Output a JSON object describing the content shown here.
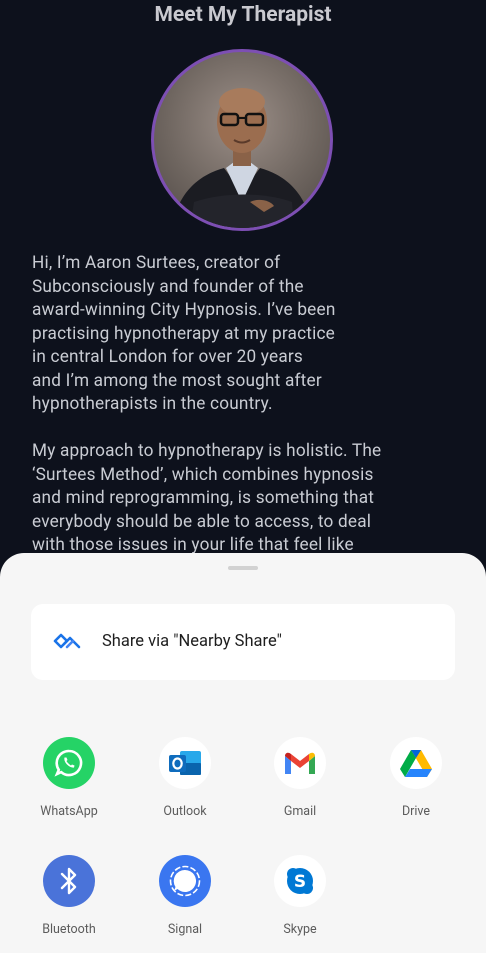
{
  "page": {
    "title": "Meet My Therapist",
    "bio_paragraphs": [
      "Hi, I’m Aaron Surtees, creator of\nSubconsciously and founder of the\naward-winning City Hypnosis. I’ve been\npractising hypnotherapy at my practice\nin central London for over 20 years\nand I’m among the most sought after\nhypnotherapists in the country.",
      "My approach to hypnotherapy is holistic. The\n‘Surtees Method’, which combines hypnosis\nand mind reprogramming, is something that\neverybody should be able to access, to deal\nwith those issues in your life that feel like"
    ],
    "avatar_ring_color": "#7d4fb3"
  },
  "share_sheet": {
    "nearby_label": "Share via \"Nearby Share\"",
    "apps": [
      {
        "label": "WhatsApp",
        "icon": "whatsapp-icon"
      },
      {
        "label": "Outlook",
        "icon": "outlook-icon"
      },
      {
        "label": "Gmail",
        "icon": "gmail-icon"
      },
      {
        "label": "Drive",
        "icon": "drive-icon"
      },
      {
        "label": "Bluetooth",
        "icon": "bluetooth-icon"
      },
      {
        "label": "Signal",
        "icon": "signal-icon"
      },
      {
        "label": "Skype",
        "icon": "skype-icon"
      }
    ]
  }
}
